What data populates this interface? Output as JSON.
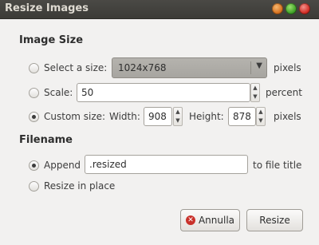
{
  "window": {
    "title": "Resize Images"
  },
  "image_size": {
    "heading": "Image Size",
    "select_size": {
      "label": "Select a size:",
      "value": "1024x768",
      "unit": "pixels",
      "selected": false
    },
    "scale": {
      "label": "Scale:",
      "value": "50",
      "unit": "percent",
      "selected": false
    },
    "custom": {
      "label": "Custom size:",
      "width_label": "Width:",
      "width_value": "908",
      "height_label": "Height:",
      "height_value": "878",
      "unit": "pixels",
      "selected": true
    }
  },
  "filename": {
    "heading": "Filename",
    "append": {
      "label": "Append",
      "value": ".resized",
      "suffix": "to file title",
      "selected": true
    },
    "in_place": {
      "label": "Resize in place",
      "selected": false
    }
  },
  "buttons": {
    "cancel": "Annulla",
    "resize": "Resize"
  }
}
